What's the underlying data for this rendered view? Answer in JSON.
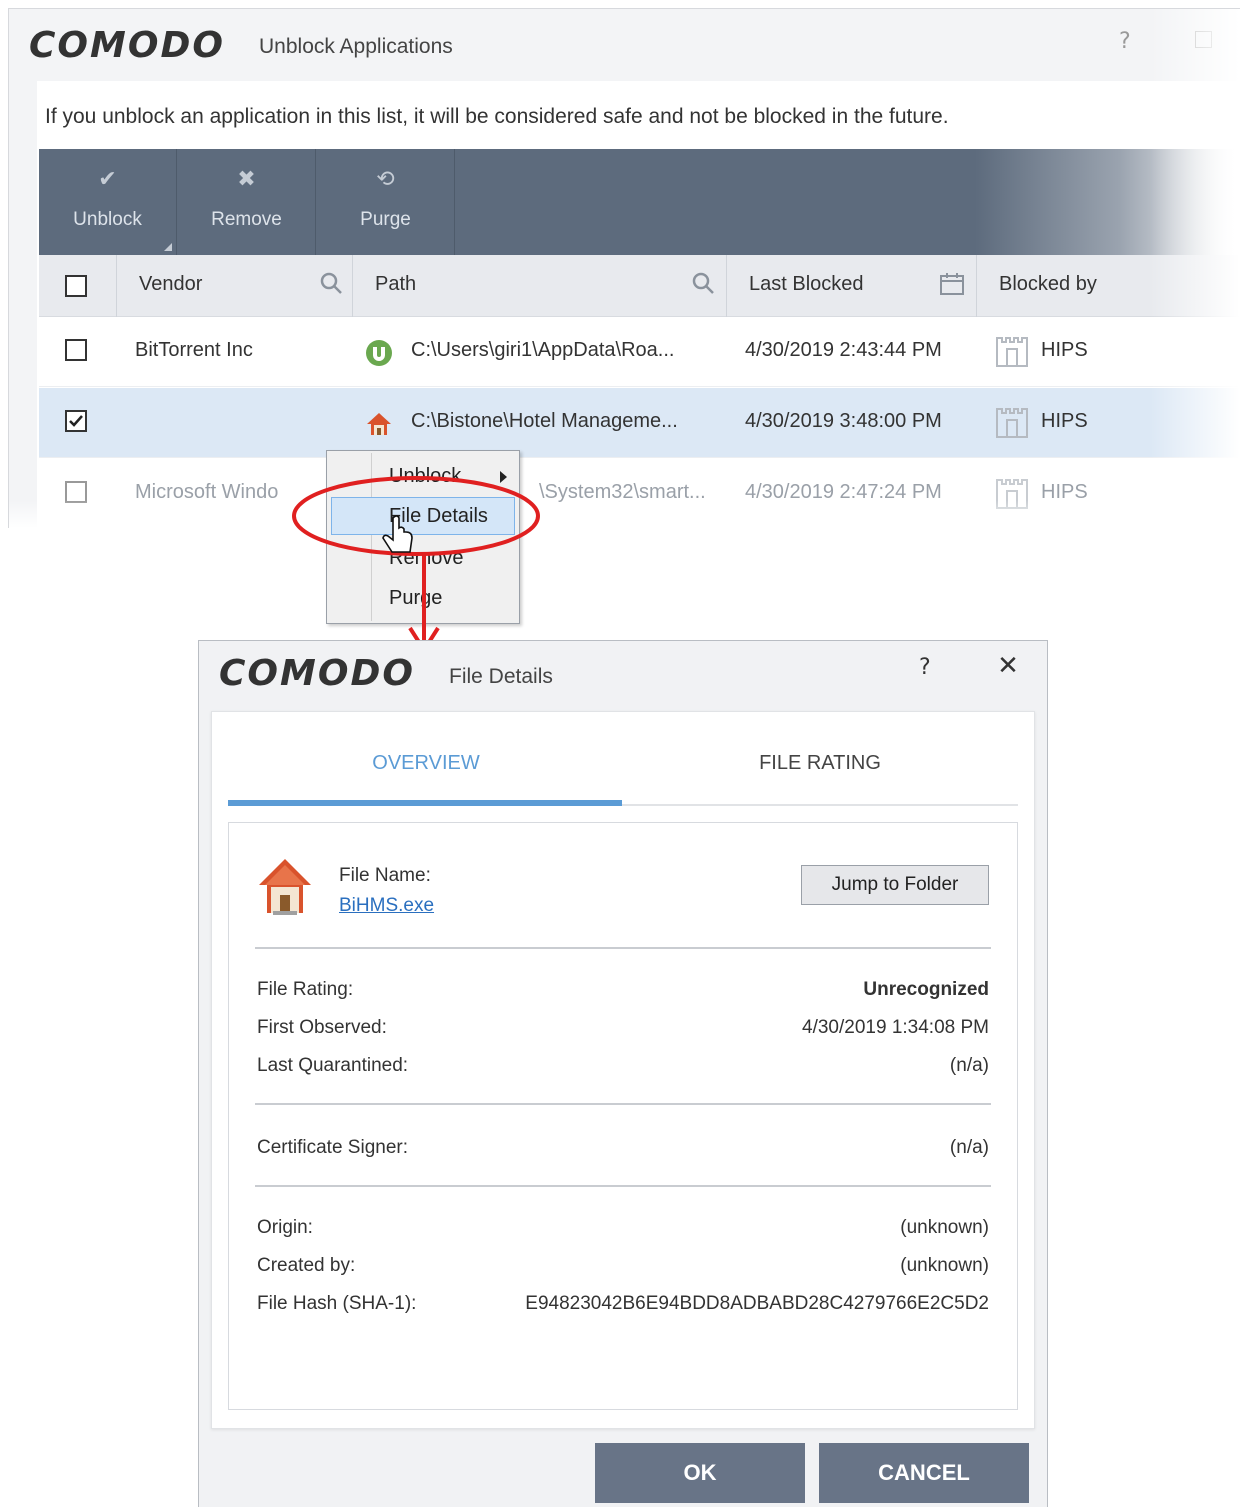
{
  "background_window": {
    "brand": "COMODO",
    "title": "Unblock Applications",
    "help": "?",
    "description": "If you unblock an application in this list, it will be considered safe and not be blocked in the future.",
    "toolbar": [
      {
        "icon": "check-icon",
        "label": "Unblock"
      },
      {
        "icon": "x-icon",
        "label": "Remove"
      },
      {
        "icon": "refresh-icon",
        "label": "Purge"
      }
    ],
    "columns": {
      "vendor": "Vendor",
      "path": "Path",
      "last_blocked": "Last Blocked",
      "blocked_by": "Blocked by"
    },
    "rows": [
      {
        "checked": false,
        "vendor": "BitTorrent Inc",
        "icon": "utorrent-icon",
        "path": "C:\\Users\\giri1\\AppData\\Roa...",
        "last_blocked": "4/30/2019 2:43:44 PM",
        "blocked_by": "HIPS"
      },
      {
        "checked": true,
        "vendor": "",
        "icon": "house-icon",
        "path": "C:\\Bistone\\Hotel Manageme...",
        "last_blocked": "4/30/2019 3:48:00 PM",
        "blocked_by": "HIPS"
      },
      {
        "checked": false,
        "vendor": "Microsoft Windo",
        "icon": "",
        "path": "\\System32\\smart...",
        "last_blocked": "4/30/2019 2:47:24 PM",
        "blocked_by": "HIPS"
      }
    ]
  },
  "context_menu": {
    "items": [
      {
        "label": "Unblock",
        "submenu": true
      },
      {
        "label": "File Details",
        "hover": true
      },
      {
        "label": "Remove"
      },
      {
        "label": "Purge"
      }
    ]
  },
  "dialog": {
    "brand": "COMODO",
    "title": "File Details",
    "help": "?",
    "close": "✕",
    "tabs": {
      "overview": "OVERVIEW",
      "file_rating": "FILE RATING",
      "active": "overview"
    },
    "file_name_label": "File Name:",
    "file_name": "BiHMS.exe",
    "jump_button": "Jump to Folder",
    "fields": {
      "file_rating": {
        "label": "File Rating:",
        "value": "Unrecognized"
      },
      "first_observed": {
        "label": "First Observed:",
        "value": "4/30/2019 1:34:08 PM"
      },
      "last_quarantined": {
        "label": "Last Quarantined:",
        "value": "(n/a)"
      },
      "certificate_signer": {
        "label": "Certificate Signer:",
        "value": "(n/a)"
      },
      "origin": {
        "label": "Origin:",
        "value": "(unknown)"
      },
      "created_by": {
        "label": "Created by:",
        "value": "(unknown)"
      },
      "file_hash": {
        "label": "File Hash (SHA-1):",
        "value": "E94823042B6E94BDD8ADBABD28C4279766E2C5D2"
      }
    },
    "ok_button": "OK",
    "cancel_button": "CANCEL"
  },
  "colors": {
    "accent": "#5b9bd5",
    "toolbar": "#5d6b7d",
    "button": "#687487",
    "annotation": "#e02020",
    "selected_row": "#dce8f5"
  }
}
